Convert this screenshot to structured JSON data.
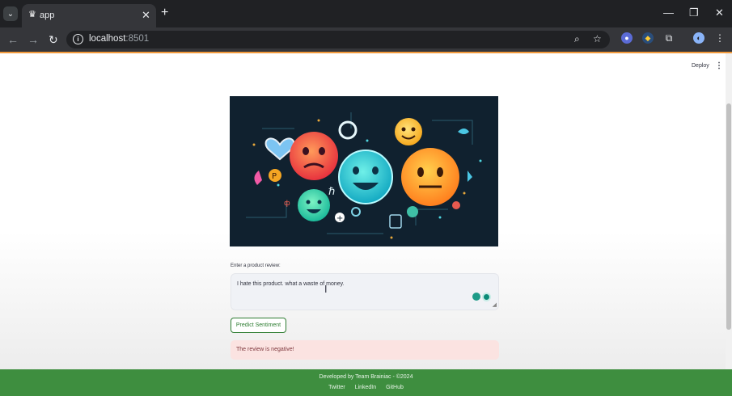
{
  "browser": {
    "tab_title": "app",
    "url_host": "localhost",
    "url_port": ":8501"
  },
  "app_header": {
    "deploy_label": "Deploy",
    "menu_glyph": "⋮"
  },
  "hero_image": {
    "icon": "emoji-sentiment-illustration"
  },
  "form": {
    "review_label": "Enter a product review:",
    "review_value": "I hate this product. what a waste of money.",
    "predict_label": "Predict Sentiment"
  },
  "result": {
    "message": "The review is negative!"
  },
  "footer": {
    "credit": "Developed by Team Brainiac - ©2024",
    "links": [
      "Twitter",
      "LinkedIn",
      "GitHub"
    ]
  },
  "colors": {
    "footer_green": "#3e8e3f",
    "alert_bg": "#fbe3e1",
    "accent_orange": "#f29a3c"
  }
}
